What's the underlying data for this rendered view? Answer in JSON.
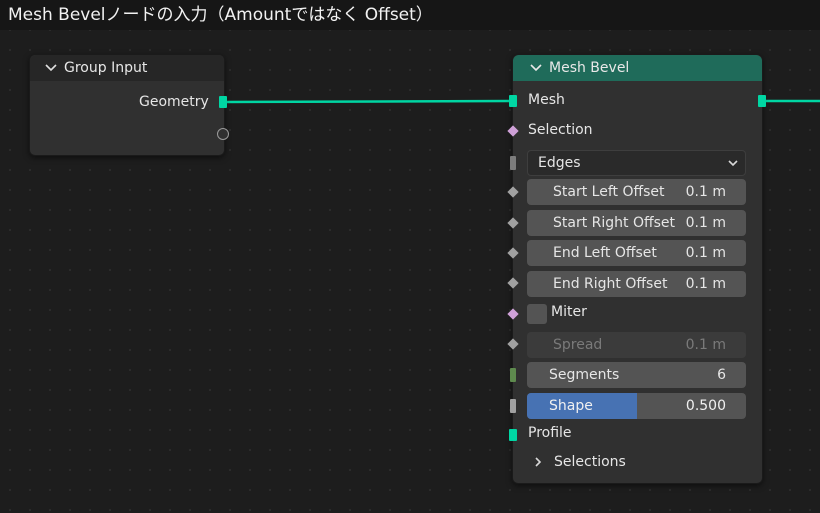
{
  "title": "Mesh Bevelノードの入力（Amountではなく Offset）",
  "group_input": {
    "header": "Group Input",
    "output_geometry": "Geometry"
  },
  "mesh_bevel": {
    "header": "Mesh Bevel",
    "input_mesh": "Mesh",
    "input_selection": "Selection",
    "mode_dropdown": "Edges",
    "fields": [
      {
        "label": "Start Left Offset",
        "value": "0.1 m"
      },
      {
        "label": "Start Right Offset",
        "value": "0.1 m"
      },
      {
        "label": "End Left Offset",
        "value": "0.1 m"
      },
      {
        "label": "End Right Offset",
        "value": "0.1 m"
      }
    ],
    "miter_label": "Miter",
    "spread": {
      "label": "Spread",
      "value": "0.1 m"
    },
    "segments": {
      "label": "Segments",
      "value": "6"
    },
    "shape": {
      "label": "Shape",
      "value": "0.500",
      "fill_fraction": 0.5
    },
    "profile_label": "Profile",
    "selections_label": "Selections"
  },
  "colors": {
    "geometry_socket": "#00d6a3",
    "bool_socket": "#cfa1d8",
    "float_socket": "#a1a1a1",
    "int_socket": "#5e8a4e",
    "mesh_bevel_header": "#1f6b5a",
    "group_input_header": "#262626",
    "shape_fill": "#4772b3"
  }
}
